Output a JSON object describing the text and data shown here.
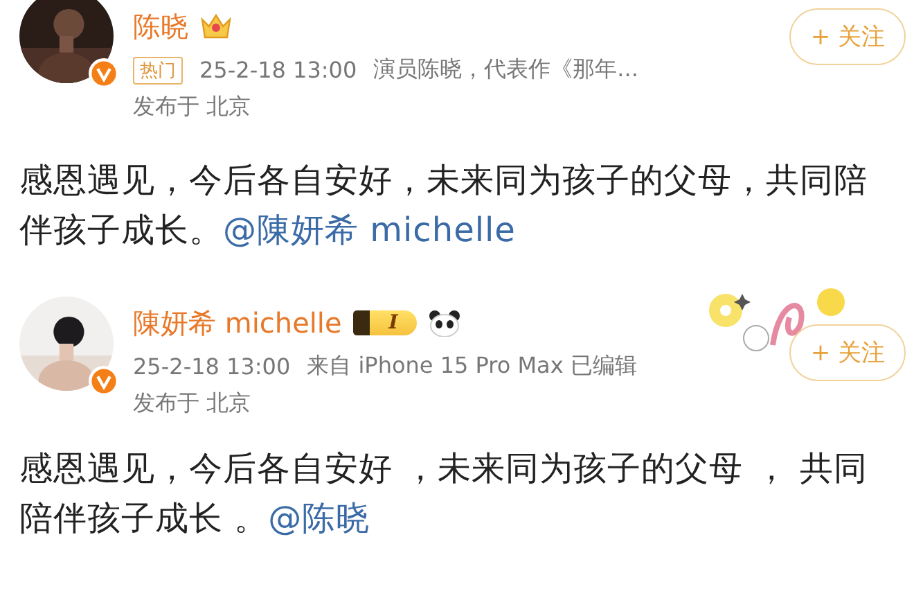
{
  "posts": [
    {
      "author": "陈晓",
      "kind": "crown",
      "tag": "热门",
      "time": "25-2-18 13:00",
      "source": "演员陈晓，代表作《那年...",
      "location": "发布于 北京",
      "follow": "+ 关注",
      "decorated": false,
      "text": "感恩遇见，今后各自安好，未来同为孩子的父母，共同陪伴孩子成长。",
      "mention": "@陳妍希 michelle"
    },
    {
      "author": "陳妍希 michelle",
      "kind": "level",
      "level_label": "I",
      "time": "25-2-18 13:00",
      "source": "来自 iPhone 15 Pro Max  已编辑",
      "location": "发布于 北京",
      "follow": "+ 关注",
      "decorated": true,
      "text": "感恩遇见，今后各自安好 ，未来同为孩子的父母 ， 共同陪伴孩子成长 。",
      "mention": "@陈晓"
    }
  ]
}
